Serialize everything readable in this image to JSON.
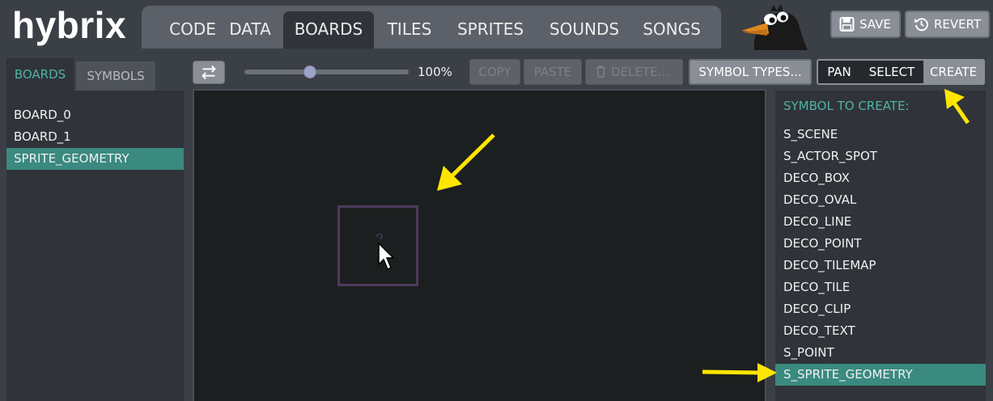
{
  "app": {
    "logo": "hybrix"
  },
  "nav_tabs": [
    {
      "label": "CODE"
    },
    {
      "label": "DATA"
    },
    {
      "label": "BOARDS"
    },
    {
      "label": "TILES"
    },
    {
      "label": "SPRITES"
    },
    {
      "label": "SOUNDS"
    },
    {
      "label": "SONGS"
    }
  ],
  "nav_active": "BOARDS",
  "header_buttons": {
    "save": "SAVE",
    "revert": "REVERT"
  },
  "left_tabs": {
    "boards": "BOARDS",
    "symbols": "SYMBOLS"
  },
  "boards": [
    {
      "label": "BOARD_0"
    },
    {
      "label": "BOARD_1"
    },
    {
      "label": "SPRITE_GEOMETRY"
    }
  ],
  "selected_board": "SPRITE_GEOMETRY",
  "toolbar": {
    "zoom_label": "100%",
    "zoom_value": 0.4,
    "copy": "COPY",
    "paste": "PASTE",
    "delete": "DELETE...",
    "symbol_types": "SYMBOL TYPES...",
    "modes": {
      "pan": "PAN",
      "select": "SELECT",
      "create": "CREATE"
    },
    "active_mode": "CREATE"
  },
  "symbols_panel": {
    "header": "SYMBOL TO CREATE:",
    "items": [
      {
        "label": "S_SCENE"
      },
      {
        "label": "S_ACTOR_SPOT"
      },
      {
        "label": "DECO_BOX"
      },
      {
        "label": "DECO_OVAL"
      },
      {
        "label": "DECO_LINE"
      },
      {
        "label": "DECO_POINT"
      },
      {
        "label": "DECO_TILEMAP"
      },
      {
        "label": "DECO_TILE"
      },
      {
        "label": "DECO_CLIP"
      },
      {
        "label": "DECO_TEXT"
      },
      {
        "label": "S_POINT"
      },
      {
        "label": "S_SPRITE_GEOMETRY"
      }
    ],
    "selected": "S_SPRITE_GEOMETRY"
  },
  "colors": {
    "accent_teal": "#4fb3a3",
    "selection_teal": "#3a8a7f",
    "annotation_yellow": "#ffe600",
    "canvas": "#1c1f20",
    "sprite_outline": "#4e3a5c"
  },
  "icons": {
    "save": "floppy-disk-icon",
    "revert": "history-icon",
    "swap": "swap-arrows-icon",
    "delete": "trash-icon",
    "mascot": "crow-mascot"
  }
}
